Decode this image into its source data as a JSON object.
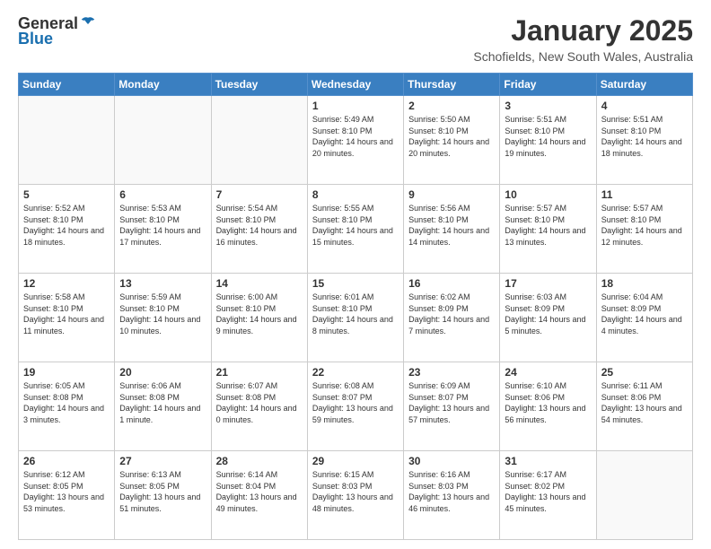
{
  "header": {
    "logo_general": "General",
    "logo_blue": "Blue",
    "title": "January 2025",
    "subtitle": "Schofields, New South Wales, Australia"
  },
  "weekdays": [
    "Sunday",
    "Monday",
    "Tuesday",
    "Wednesday",
    "Thursday",
    "Friday",
    "Saturday"
  ],
  "weeks": [
    [
      {
        "day": "",
        "info": ""
      },
      {
        "day": "",
        "info": ""
      },
      {
        "day": "",
        "info": ""
      },
      {
        "day": "1",
        "info": "Sunrise: 5:49 AM\nSunset: 8:10 PM\nDaylight: 14 hours and 20 minutes."
      },
      {
        "day": "2",
        "info": "Sunrise: 5:50 AM\nSunset: 8:10 PM\nDaylight: 14 hours and 20 minutes."
      },
      {
        "day": "3",
        "info": "Sunrise: 5:51 AM\nSunset: 8:10 PM\nDaylight: 14 hours and 19 minutes."
      },
      {
        "day": "4",
        "info": "Sunrise: 5:51 AM\nSunset: 8:10 PM\nDaylight: 14 hours and 18 minutes."
      }
    ],
    [
      {
        "day": "5",
        "info": "Sunrise: 5:52 AM\nSunset: 8:10 PM\nDaylight: 14 hours and 18 minutes."
      },
      {
        "day": "6",
        "info": "Sunrise: 5:53 AM\nSunset: 8:10 PM\nDaylight: 14 hours and 17 minutes."
      },
      {
        "day": "7",
        "info": "Sunrise: 5:54 AM\nSunset: 8:10 PM\nDaylight: 14 hours and 16 minutes."
      },
      {
        "day": "8",
        "info": "Sunrise: 5:55 AM\nSunset: 8:10 PM\nDaylight: 14 hours and 15 minutes."
      },
      {
        "day": "9",
        "info": "Sunrise: 5:56 AM\nSunset: 8:10 PM\nDaylight: 14 hours and 14 minutes."
      },
      {
        "day": "10",
        "info": "Sunrise: 5:57 AM\nSunset: 8:10 PM\nDaylight: 14 hours and 13 minutes."
      },
      {
        "day": "11",
        "info": "Sunrise: 5:57 AM\nSunset: 8:10 PM\nDaylight: 14 hours and 12 minutes."
      }
    ],
    [
      {
        "day": "12",
        "info": "Sunrise: 5:58 AM\nSunset: 8:10 PM\nDaylight: 14 hours and 11 minutes."
      },
      {
        "day": "13",
        "info": "Sunrise: 5:59 AM\nSunset: 8:10 PM\nDaylight: 14 hours and 10 minutes."
      },
      {
        "day": "14",
        "info": "Sunrise: 6:00 AM\nSunset: 8:10 PM\nDaylight: 14 hours and 9 minutes."
      },
      {
        "day": "15",
        "info": "Sunrise: 6:01 AM\nSunset: 8:10 PM\nDaylight: 14 hours and 8 minutes."
      },
      {
        "day": "16",
        "info": "Sunrise: 6:02 AM\nSunset: 8:09 PM\nDaylight: 14 hours and 7 minutes."
      },
      {
        "day": "17",
        "info": "Sunrise: 6:03 AM\nSunset: 8:09 PM\nDaylight: 14 hours and 5 minutes."
      },
      {
        "day": "18",
        "info": "Sunrise: 6:04 AM\nSunset: 8:09 PM\nDaylight: 14 hours and 4 minutes."
      }
    ],
    [
      {
        "day": "19",
        "info": "Sunrise: 6:05 AM\nSunset: 8:08 PM\nDaylight: 14 hours and 3 minutes."
      },
      {
        "day": "20",
        "info": "Sunrise: 6:06 AM\nSunset: 8:08 PM\nDaylight: 14 hours and 1 minute."
      },
      {
        "day": "21",
        "info": "Sunrise: 6:07 AM\nSunset: 8:08 PM\nDaylight: 14 hours and 0 minutes."
      },
      {
        "day": "22",
        "info": "Sunrise: 6:08 AM\nSunset: 8:07 PM\nDaylight: 13 hours and 59 minutes."
      },
      {
        "day": "23",
        "info": "Sunrise: 6:09 AM\nSunset: 8:07 PM\nDaylight: 13 hours and 57 minutes."
      },
      {
        "day": "24",
        "info": "Sunrise: 6:10 AM\nSunset: 8:06 PM\nDaylight: 13 hours and 56 minutes."
      },
      {
        "day": "25",
        "info": "Sunrise: 6:11 AM\nSunset: 8:06 PM\nDaylight: 13 hours and 54 minutes."
      }
    ],
    [
      {
        "day": "26",
        "info": "Sunrise: 6:12 AM\nSunset: 8:05 PM\nDaylight: 13 hours and 53 minutes."
      },
      {
        "day": "27",
        "info": "Sunrise: 6:13 AM\nSunset: 8:05 PM\nDaylight: 13 hours and 51 minutes."
      },
      {
        "day": "28",
        "info": "Sunrise: 6:14 AM\nSunset: 8:04 PM\nDaylight: 13 hours and 49 minutes."
      },
      {
        "day": "29",
        "info": "Sunrise: 6:15 AM\nSunset: 8:03 PM\nDaylight: 13 hours and 48 minutes."
      },
      {
        "day": "30",
        "info": "Sunrise: 6:16 AM\nSunset: 8:03 PM\nDaylight: 13 hours and 46 minutes."
      },
      {
        "day": "31",
        "info": "Sunrise: 6:17 AM\nSunset: 8:02 PM\nDaylight: 13 hours and 45 minutes."
      },
      {
        "day": "",
        "info": ""
      }
    ]
  ]
}
